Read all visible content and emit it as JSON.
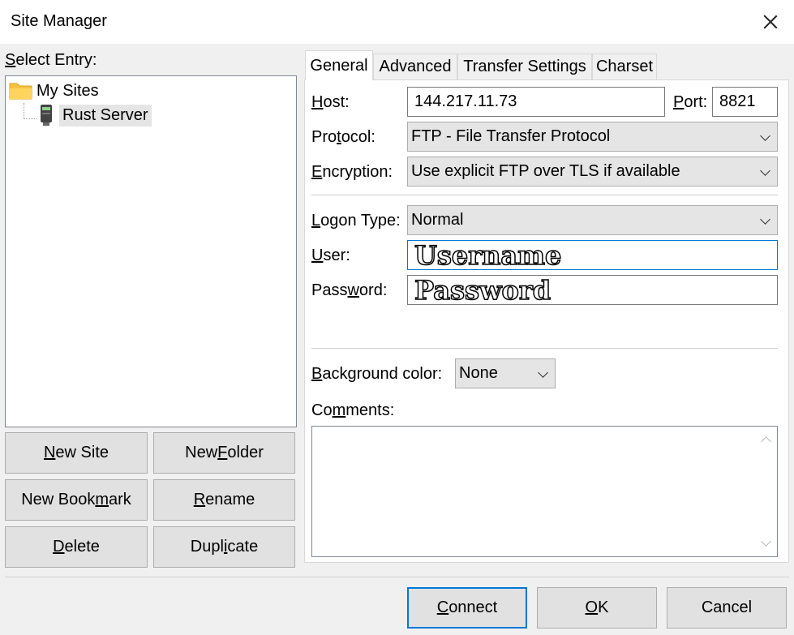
{
  "window": {
    "title": "Site Manager"
  },
  "select_entry_label": "Select Entry:",
  "tree": {
    "root": {
      "label": "My Sites",
      "icon": "folder-icon"
    },
    "children": [
      {
        "label": "Rust Server",
        "icon": "server-icon"
      }
    ]
  },
  "left_buttons": {
    "new_site": "New Site",
    "new_folder": "New Folder",
    "new_bookmark": "New Bookmark",
    "rename": "Rename",
    "delete": "Delete",
    "duplicate": "Duplicate"
  },
  "tabs": [
    {
      "label": "General",
      "active": true
    },
    {
      "label": "Advanced",
      "active": false
    },
    {
      "label": "Transfer Settings",
      "active": false
    },
    {
      "label": "Charset",
      "active": false
    }
  ],
  "general": {
    "host_label": "Host:",
    "host_value": "144.217.11.73",
    "port_label": "Port:",
    "port_value": "8821",
    "protocol_label": "Protocol:",
    "protocol_value": "FTP - File Transfer Protocol",
    "encryption_label": "Encryption:",
    "encryption_value": "Use explicit FTP over TLS if available",
    "logon_type_label": "Logon Type:",
    "logon_type_value": "Normal",
    "user_label": "User:",
    "user_value": "Username",
    "password_label": "Password:",
    "password_value": "Password",
    "bg_color_label": "Background color:",
    "bg_color_value": "None",
    "comments_label": "Comments:",
    "comments_value": ""
  },
  "footer": {
    "connect": "Connect",
    "ok": "OK",
    "cancel": "Cancel"
  },
  "colors": {
    "accent": "#0078d7",
    "folder": "#f5c242"
  }
}
